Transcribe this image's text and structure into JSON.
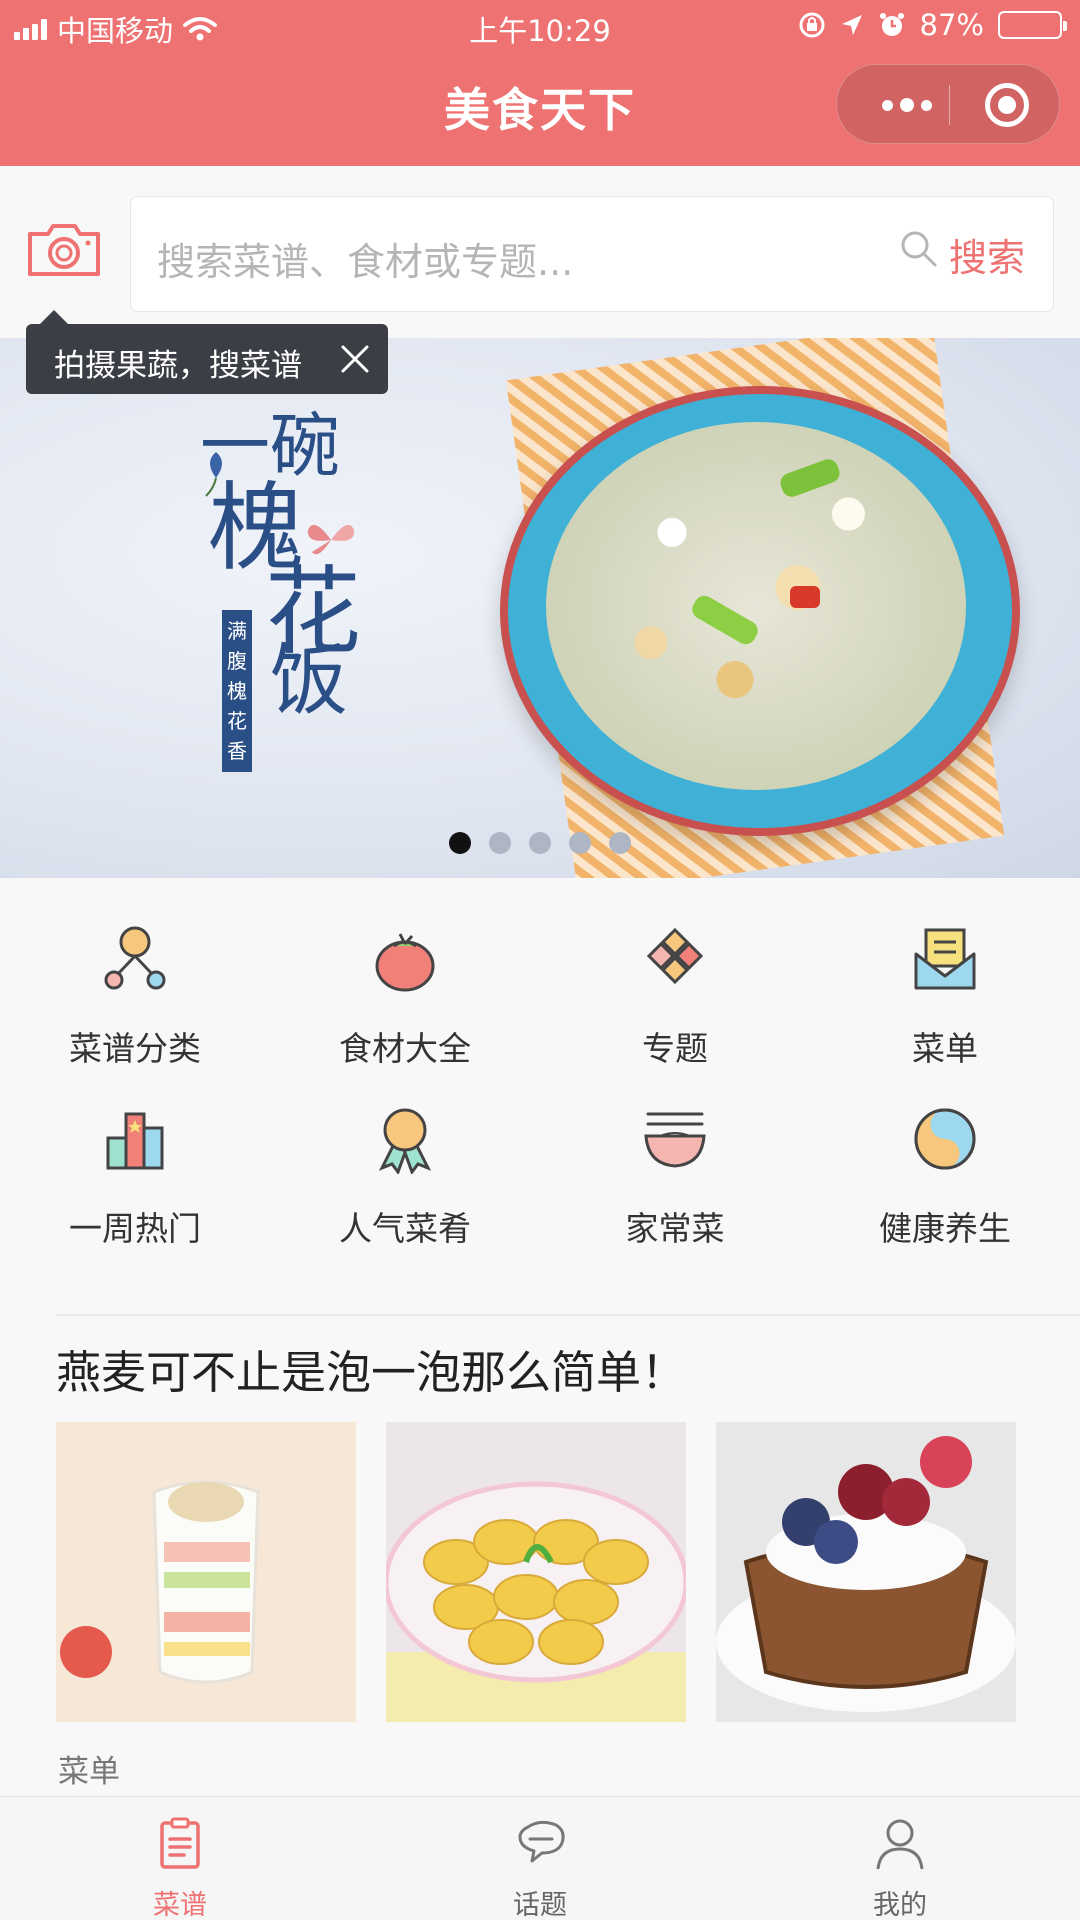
{
  "status_bar": {
    "carrier": "中国移动",
    "time": "上午10:29",
    "battery_text": "87%",
    "battery_level": 0.87
  },
  "nav": {
    "title": "美食天下",
    "more_icon": "more-dots-icon",
    "close_icon": "target-circle-icon"
  },
  "search": {
    "camera_icon": "camera-icon",
    "placeholder": "搜索菜谱、食材或专题...",
    "button_label": "搜索"
  },
  "tooltip": {
    "text": "拍摄果蔬，搜菜谱"
  },
  "banner": {
    "line1": "一碗",
    "line2": "槐",
    "line3": "花",
    "line4": "饭",
    "tagline": "满腹槐花香",
    "slide_count": 5,
    "active_slide": 1
  },
  "categories": [
    {
      "label": "菜谱分类",
      "icon": "recipe-category-icon"
    },
    {
      "label": "食材大全",
      "icon": "tomato-icon"
    },
    {
      "label": "专题",
      "icon": "diamond-tiles-icon"
    },
    {
      "label": "菜单",
      "icon": "menu-envelope-icon"
    },
    {
      "label": "一周热门",
      "icon": "bar-chart-icon"
    },
    {
      "label": "人气菜肴",
      "icon": "award-medal-icon"
    },
    {
      "label": "家常菜",
      "icon": "noodle-bowl-icon"
    },
    {
      "label": "健康养生",
      "icon": "yin-yang-icon"
    }
  ],
  "article": {
    "title": "燕麦可不止是泡一泡那么简单！",
    "type_label": "菜单"
  },
  "tabbar": {
    "items": [
      {
        "label": "菜谱",
        "icon": "recipe-list-icon",
        "active": true
      },
      {
        "label": "话题",
        "icon": "chat-bubbles-icon",
        "active": false
      },
      {
        "label": "我的",
        "icon": "user-icon",
        "active": false
      }
    ]
  },
  "colors": {
    "brand": "#ee7271",
    "banner_text": "#2a4e86"
  }
}
